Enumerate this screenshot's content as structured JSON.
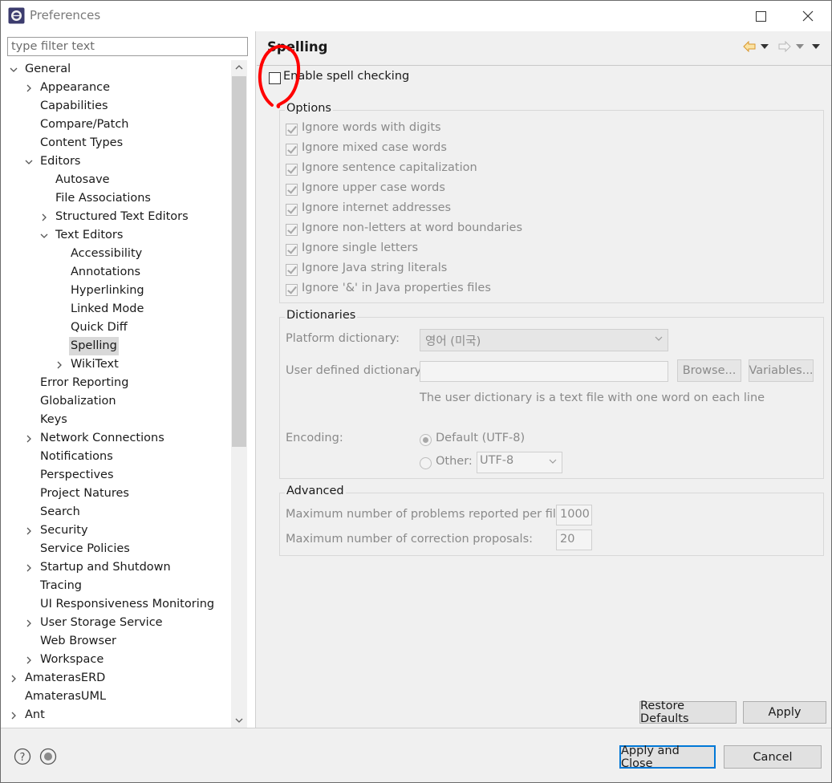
{
  "window": {
    "title": "Preferences"
  },
  "filter": {
    "placeholder": "type filter text"
  },
  "tree": [
    {
      "label": "General",
      "depth": 0,
      "twisty": "expanded"
    },
    {
      "label": "Appearance",
      "depth": 1,
      "twisty": "collapsed"
    },
    {
      "label": "Capabilities",
      "depth": 1,
      "twisty": "none"
    },
    {
      "label": "Compare/Patch",
      "depth": 1,
      "twisty": "none"
    },
    {
      "label": "Content Types",
      "depth": 1,
      "twisty": "none"
    },
    {
      "label": "Editors",
      "depth": 1,
      "twisty": "expanded"
    },
    {
      "label": "Autosave",
      "depth": 2,
      "twisty": "none"
    },
    {
      "label": "File Associations",
      "depth": 2,
      "twisty": "none"
    },
    {
      "label": "Structured Text Editors",
      "depth": 2,
      "twisty": "collapsed"
    },
    {
      "label": "Text Editors",
      "depth": 2,
      "twisty": "expanded"
    },
    {
      "label": "Accessibility",
      "depth": 3,
      "twisty": "none"
    },
    {
      "label": "Annotations",
      "depth": 3,
      "twisty": "none"
    },
    {
      "label": "Hyperlinking",
      "depth": 3,
      "twisty": "none"
    },
    {
      "label": "Linked Mode",
      "depth": 3,
      "twisty": "none"
    },
    {
      "label": "Quick Diff",
      "depth": 3,
      "twisty": "none"
    },
    {
      "label": "Spelling",
      "depth": 3,
      "twisty": "none",
      "selected": true
    },
    {
      "label": "WikiText",
      "depth": 3,
      "twisty": "collapsed"
    },
    {
      "label": "Error Reporting",
      "depth": 1,
      "twisty": "none"
    },
    {
      "label": "Globalization",
      "depth": 1,
      "twisty": "none"
    },
    {
      "label": "Keys",
      "depth": 1,
      "twisty": "none"
    },
    {
      "label": "Network Connections",
      "depth": 1,
      "twisty": "collapsed"
    },
    {
      "label": "Notifications",
      "depth": 1,
      "twisty": "none"
    },
    {
      "label": "Perspectives",
      "depth": 1,
      "twisty": "none"
    },
    {
      "label": "Project Natures",
      "depth": 1,
      "twisty": "none"
    },
    {
      "label": "Search",
      "depth": 1,
      "twisty": "none"
    },
    {
      "label": "Security",
      "depth": 1,
      "twisty": "collapsed"
    },
    {
      "label": "Service Policies",
      "depth": 1,
      "twisty": "none"
    },
    {
      "label": "Startup and Shutdown",
      "depth": 1,
      "twisty": "collapsed"
    },
    {
      "label": "Tracing",
      "depth": 1,
      "twisty": "none"
    },
    {
      "label": "UI Responsiveness Monitoring",
      "depth": 1,
      "twisty": "none"
    },
    {
      "label": "User Storage Service",
      "depth": 1,
      "twisty": "collapsed"
    },
    {
      "label": "Web Browser",
      "depth": 1,
      "twisty": "none"
    },
    {
      "label": "Workspace",
      "depth": 1,
      "twisty": "collapsed"
    },
    {
      "label": "AmaterasERD",
      "depth": 0,
      "twisty": "collapsed"
    },
    {
      "label": "AmaterasUML",
      "depth": 0,
      "twisty": "none"
    },
    {
      "label": "Ant",
      "depth": 0,
      "twisty": "collapsed"
    }
  ],
  "page": {
    "title": "Spelling",
    "enable_label": "Enable spell checking",
    "enable_checked": false,
    "options": {
      "title": "Options",
      "items": [
        "Ignore words with digits",
        "Ignore mixed case words",
        "Ignore sentence capitalization",
        "Ignore upper case words",
        "Ignore internet addresses",
        "Ignore non-letters at word boundaries",
        "Ignore single letters",
        "Ignore Java string literals",
        "Ignore '&' in Java properties files"
      ]
    },
    "dictionaries": {
      "title": "Dictionaries",
      "platform_label": "Platform dictionary:",
      "platform_value": "영어 (미국)",
      "user_label": "User defined dictionary:",
      "user_value": "",
      "browse_label": "Browse...",
      "variables_label": "Variables...",
      "hint": "The user dictionary is a text file with one word on each line",
      "encoding_label": "Encoding:",
      "default_label": "Default (UTF-8)",
      "other_label": "Other:",
      "other_value": "UTF-8"
    },
    "advanced": {
      "title": "Advanced",
      "max_problems_label": "Maximum number of problems reported per file:",
      "max_problems_value": "1000",
      "max_proposals_label": "Maximum number of correction proposals:",
      "max_proposals_value": "20"
    },
    "restore_defaults_label": "Restore Defaults",
    "apply_label": "Apply"
  },
  "footer": {
    "apply_close_label": "Apply and Close",
    "cancel_label": "Cancel"
  },
  "colors": {
    "accent": "#0078d7",
    "annotation": "#ff0000",
    "nav_arrow": "#e8a33c"
  }
}
